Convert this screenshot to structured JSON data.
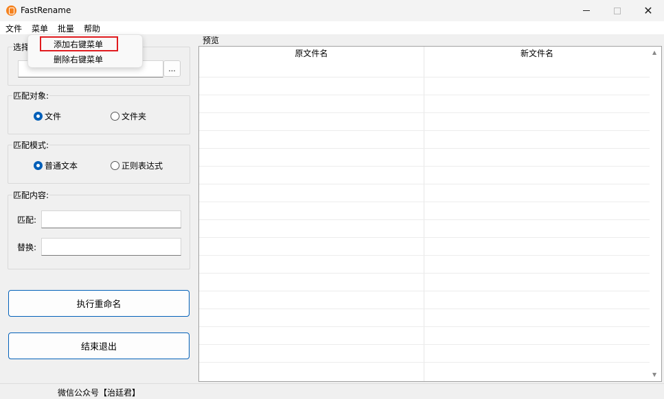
{
  "window": {
    "title": "FastRename",
    "minimize_glyph": "",
    "maximize_glyph": "",
    "close_glyph": "✕"
  },
  "menubar": {
    "items": [
      "文件",
      "菜单",
      "批量",
      "帮助"
    ]
  },
  "dropdown": {
    "items": [
      "添加右键菜单",
      "删除右键菜单"
    ]
  },
  "left": {
    "select_group_title": "选择",
    "path_value": "",
    "browse_label": "...",
    "match_target": {
      "title": "匹配对象:",
      "options": [
        "文件",
        "文件夹"
      ],
      "selected": "文件"
    },
    "match_mode": {
      "title": "匹配模式:",
      "options": [
        "普通文本",
        "正则表达式"
      ],
      "selected": "普通文本"
    },
    "match_content": {
      "title": "匹配内容:",
      "match_label": "匹配:",
      "match_value": "",
      "replace_label": "替换:",
      "replace_value": ""
    },
    "execute_button": "执行重命名",
    "exit_button": "结束退出"
  },
  "preview": {
    "label": "预览",
    "columns": [
      "原文件名",
      "新文件名"
    ],
    "rows": []
  },
  "statusbar": {
    "text": "微信公众号【治廷君】"
  },
  "colors": {
    "accent": "#005fb8",
    "highlight_border": "#e0191d",
    "app_icon": "#f5821f"
  }
}
